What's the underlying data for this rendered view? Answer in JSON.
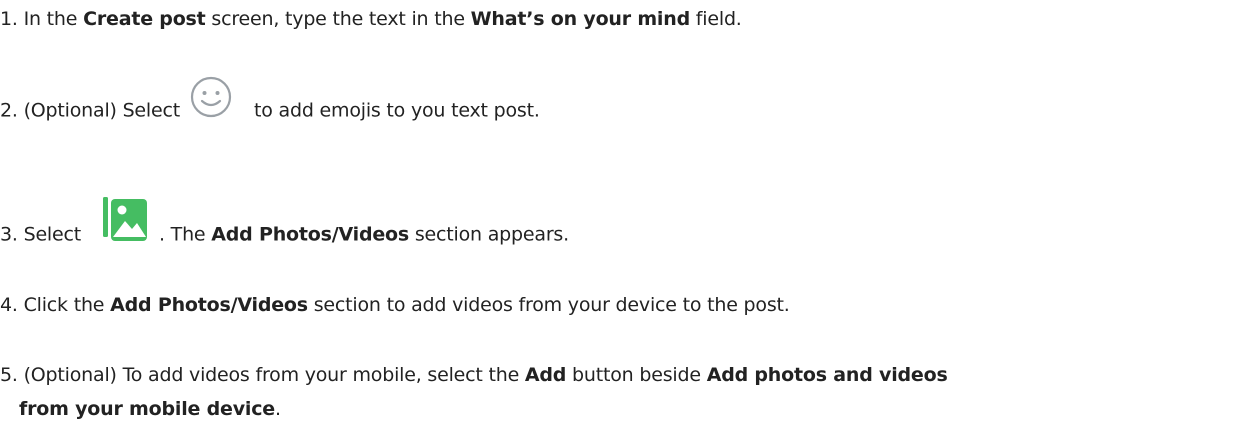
{
  "steps": [
    {
      "num": "1.",
      "t1": "In the ",
      "b1": "Create post",
      "t2": " screen, type the text in the ",
      "b2": "What’s on your mind",
      "t3": " field."
    },
    {
      "num": "2.",
      "t1": "(Optional) Select",
      "icon": "smiley-face-icon",
      "t2": "to add emojis to you text post."
    },
    {
      "num": "3.",
      "t1": "Select",
      "icon": "photos-videos-icon",
      "t2": ". The ",
      "b1": "Add Photos/Videos",
      "t3": " section appears."
    },
    {
      "num": "4.",
      "t1": "Click the ",
      "b1": "Add Photos/Videos",
      "t2": " section to add videos from your device to the post."
    },
    {
      "num": "5.",
      "t1": "(Optional) To add videos from your mobile, select the ",
      "b1": "Add",
      "t2": " button beside ",
      "b2": "Add photos and videos",
      "b3": "from your mobile device",
      "t3": "."
    }
  ],
  "colors": {
    "text": "#222222",
    "emoji_icon_stroke": "#9aa0a6",
    "photo_icon_green": "#45bd62"
  }
}
